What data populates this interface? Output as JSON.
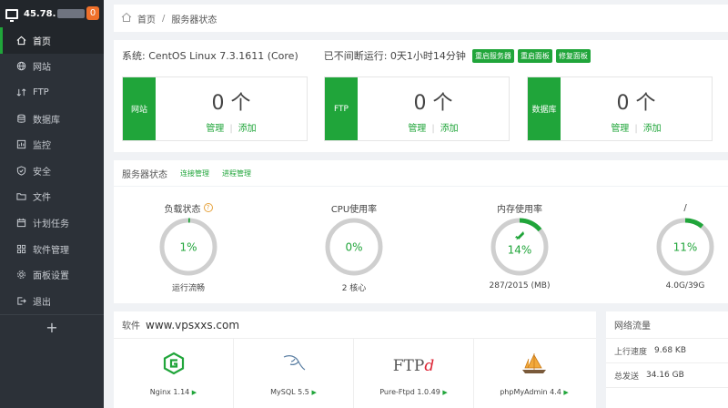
{
  "sidebar": {
    "ip": "45.78.",
    "badge": "0",
    "items": [
      {
        "label": "首页",
        "icon": "home-icon",
        "active": true
      },
      {
        "label": "网站",
        "icon": "globe-icon"
      },
      {
        "label": "FTP",
        "icon": "ftp-icon"
      },
      {
        "label": "数据库",
        "icon": "database-icon"
      },
      {
        "label": "监控",
        "icon": "monitor-icon"
      },
      {
        "label": "安全",
        "icon": "shield-icon"
      },
      {
        "label": "文件",
        "icon": "folder-icon"
      },
      {
        "label": "计划任务",
        "icon": "calendar-icon"
      },
      {
        "label": "软件管理",
        "icon": "grid-icon"
      },
      {
        "label": "面板设置",
        "icon": "gear-icon"
      },
      {
        "label": "退出",
        "icon": "logout-icon"
      }
    ],
    "add": "+"
  },
  "breadcrumb": {
    "home": "首页",
    "sep": "/",
    "current": "服务器状态"
  },
  "system": {
    "os": "系统: CentOS Linux 7.3.1611 (Core)",
    "uptime": "已不间断运行: 0天1小时14分钟",
    "buttons": [
      "重启服务器",
      "重启面板",
      "修复面板"
    ]
  },
  "cards": [
    {
      "tag": "网站",
      "count": "0 个",
      "manage": "管理",
      "add": "添加"
    },
    {
      "tag": "FTP",
      "count": "0 个",
      "manage": "管理",
      "add": "添加"
    },
    {
      "tag": "数据库",
      "count": "0 个",
      "manage": "管理",
      "add": "添加"
    }
  ],
  "status": {
    "title": "服务器状态",
    "links": [
      "连接管理",
      "进程管理"
    ],
    "gauges": [
      {
        "title": "负载状态",
        "value": "1%",
        "percent": 1,
        "sub": "运行流畅",
        "help": "?"
      },
      {
        "title": "CPU使用率",
        "value": "0%",
        "percent": 0,
        "sub": "2 核心"
      },
      {
        "title": "内存使用率",
        "value": "14%",
        "percent": 14,
        "sub": "287/2015 (MB)"
      },
      {
        "title": "/",
        "value": "11%",
        "percent": 11,
        "sub": "4.0G/39G"
      }
    ]
  },
  "software": {
    "title": "软件",
    "watermark": "www.vpsxxs.com",
    "items": [
      {
        "name": "Nginx 1.14",
        "icon": "nginx-icon"
      },
      {
        "name": "MySQL 5.5",
        "icon": "mysql-dolphin-icon"
      },
      {
        "name": "Pure-Ftpd 1.0.49",
        "icon": "ftpd-icon",
        "logo_text": "FTP",
        "logo_suffix": "d"
      },
      {
        "name": "phpMyAdmin 4.4",
        "icon": "phpmyadmin-sailboat-icon"
      }
    ]
  },
  "network": {
    "title": "网络流量",
    "rows": [
      {
        "label": "上行速度",
        "value": "9.68 KB"
      },
      {
        "label": "总发送",
        "value": "34.16 GB"
      }
    ]
  },
  "colors": {
    "accent": "#20a53a",
    "sidebar": "#2c3138",
    "badge": "#f0702a",
    "gauge_track": "#cfcfcf"
  }
}
